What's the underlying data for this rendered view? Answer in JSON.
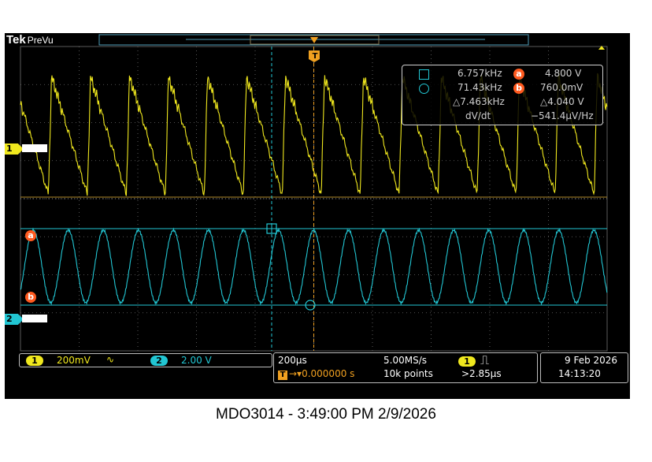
{
  "header": {
    "brand": "Tek",
    "mode": "PreVu"
  },
  "trigger": {
    "label": "T"
  },
  "measurements": {
    "row1": {
      "left": "6.757kHz",
      "cursor": "a",
      "right": "4.800 V"
    },
    "row2": {
      "left": "71.43kHz",
      "cursor": "b",
      "right": "760.0mV"
    },
    "row3": {
      "left": "△7.463kHz",
      "right": "△4.040 V"
    },
    "row4": {
      "left": "dV/dt",
      "right": "−541.4µV/Hz"
    }
  },
  "side_markers": {
    "cursor_a": "a",
    "cursor_b": "b",
    "ch1": "1",
    "ch2": "2"
  },
  "bottom": {
    "ch1": {
      "num": "1",
      "scale": "200mV",
      "coupling": "∿"
    },
    "ch2": {
      "num": "2",
      "scale": "2.00 V"
    },
    "horizontal": {
      "timebase": "200µs",
      "delay_icon": "T",
      "delay": "→▾0.000000 s"
    },
    "acq": {
      "rate": "5.00MS/s",
      "points": "10k points"
    },
    "trig": {
      "num": "1",
      "icon": "⎍",
      "level": ">2.85µs"
    },
    "datetime": {
      "date": "9 Feb  2026",
      "time": "14:13:20"
    }
  },
  "caption": "MDO3014 - 3:49:00 PM   2/9/2026",
  "colors": {
    "ch1": "#f0e81e",
    "ch2": "#22c6d3",
    "cursor": "#ff5a1f",
    "grid": "#8a8a8a"
  }
}
